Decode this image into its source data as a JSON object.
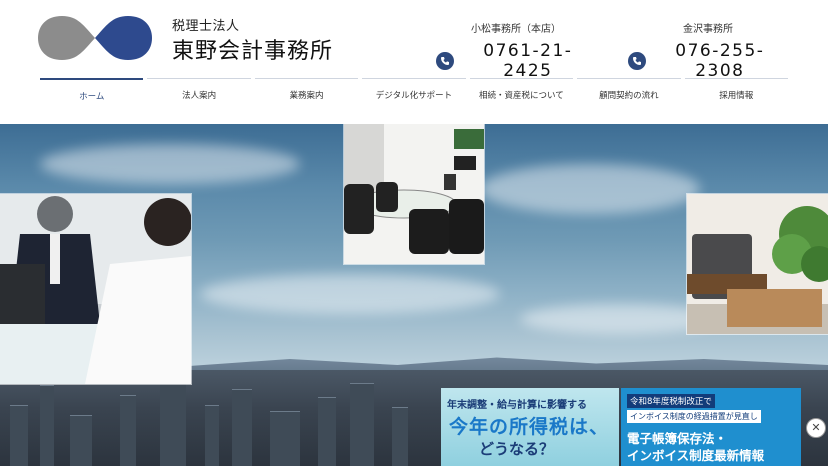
{
  "header": {
    "firm_type": "税理士法人",
    "firm_name": "東野会計事務所",
    "offices": [
      {
        "name": "小松事務所（本店）",
        "phone": "0761-21-2425"
      },
      {
        "name": "金沢事務所",
        "phone": "076-255-2308"
      }
    ]
  },
  "nav": {
    "items": [
      {
        "label": "ホーム",
        "active": true
      },
      {
        "label": "法人案内"
      },
      {
        "label": "業務案内"
      },
      {
        "label": "デジタル化サポート"
      },
      {
        "label": "相続・資産税について"
      },
      {
        "label": "顧問契約の流れ"
      },
      {
        "label": "採用情報"
      }
    ]
  },
  "banners": {
    "tax_banner": {
      "line1": "年末調整・給与計算に影響する",
      "line2": "今年の所得税は、",
      "line3": "どうなる？"
    },
    "reform_banner": {
      "tag": "令和8年度税制改正で",
      "line2": "インボイス制度の経過措置が見直し",
      "line3": "電子帳簿保存法・",
      "line4": "インボイス制度最新情報"
    },
    "close_label": "✕"
  },
  "colors": {
    "brand": "#2e4a7e",
    "accent": "#1a78c8"
  }
}
